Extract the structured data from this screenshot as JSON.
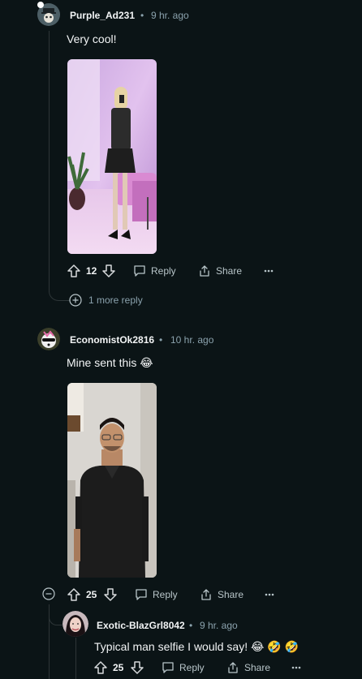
{
  "comments": [
    {
      "username": "Purple_Ad231",
      "separator": "•",
      "time": "9 hr. ago",
      "text": "Very cool!",
      "votes": "12",
      "reply_label": "Reply",
      "share_label": "Share",
      "more_replies": "1 more reply"
    },
    {
      "username": "EconomistOk2816",
      "separator": "•",
      "time": "10 hr. ago",
      "text": "Mine sent this 😂",
      "votes": "25",
      "reply_label": "Reply",
      "share_label": "Share"
    },
    {
      "username": "Exotic-BlazGrl8042",
      "separator": "•",
      "time": "9 hr. ago",
      "text": "Typical man selfie I would say! 😂 🤣 🤣",
      "votes": "25",
      "reply_label": "Reply",
      "share_label": "Share"
    }
  ],
  "icons": {
    "upvote": "upvote-icon",
    "downvote": "downvote-icon",
    "reply": "comment-icon",
    "share": "share-icon",
    "more": "ellipsis-icon",
    "expand": "plus-circle-icon",
    "collapse": "minus-circle-icon"
  },
  "colors": {
    "background": "#0b1416",
    "text": "#f2f4f5",
    "meta": "#8ba2ad",
    "thread_line": "#2e3638"
  }
}
